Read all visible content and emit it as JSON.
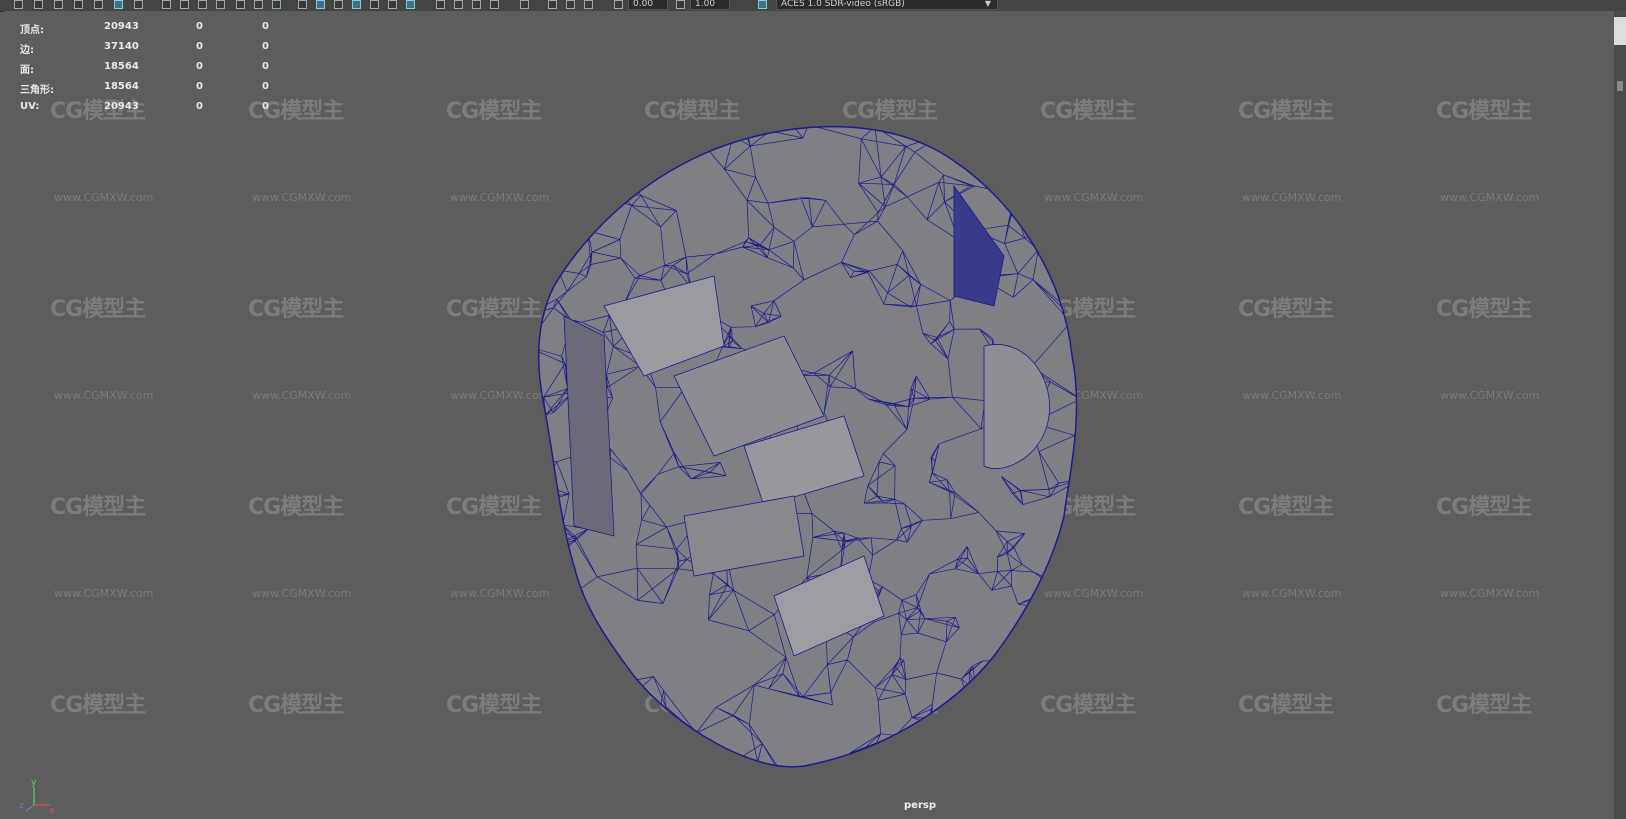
{
  "toolbar": {
    "exposure_value": "0.00",
    "gamma_value": "1.00",
    "color_management": "ACES 1.0 SDR-video (sRGB)"
  },
  "hud": {
    "rows": [
      {
        "label": "顶点:",
        "values": [
          "20943",
          "0",
          "0"
        ]
      },
      {
        "label": "边:",
        "values": [
          "37140",
          "0",
          "0"
        ]
      },
      {
        "label": "面:",
        "values": [
          "18564",
          "0",
          "0"
        ]
      },
      {
        "label": "三角形:",
        "values": [
          "18564",
          "0",
          "0"
        ]
      },
      {
        "label": "UV:",
        "values": [
          "20943",
          "0",
          "0"
        ]
      }
    ]
  },
  "viewport": {
    "camera_label": "persp",
    "axis_labels": {
      "x": "x",
      "y": "y",
      "z": "z"
    },
    "watermark_logo": "CG模型主",
    "watermark_url": "www.CGMXW.com",
    "wireframe_color": "#1a1a8c",
    "background_color": "#5d5d5d"
  },
  "icons": [
    "select-tool-icon",
    "camera-icon",
    "grid-icon",
    "shading-icon",
    "light-icon",
    "exposure-icon",
    "gamma-icon",
    "color-management-icon"
  ]
}
